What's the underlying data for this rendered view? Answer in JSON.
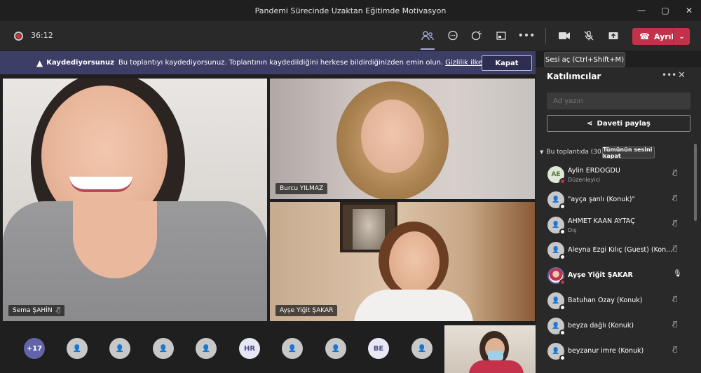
{
  "window": {
    "title": "Pandemi Sürecinde Uzaktan Eğitimde Motivasyon",
    "controls": [
      "—",
      "▢",
      "✕"
    ]
  },
  "toolbar": {
    "timer": "36:12",
    "leave_label": "Ayrıl",
    "tooltip": "Sesi aç (Ctrl+Shift+M)"
  },
  "banner": {
    "title": "Kaydediyorsunuz",
    "message": "Bu toplantıyı kaydediyorsunuz. Toplantının kaydedildiğini herkese bildirdiğinizden emin olun.",
    "link": "Gizlilik ilkesi",
    "dismiss": "Kapat"
  },
  "videos": [
    {
      "name": "Sema ŞAHİN"
    },
    {
      "name": "Burcu YILMAZ"
    },
    {
      "name": "Ayşe Yiğit ŞAKAR"
    }
  ],
  "bottom_bar": {
    "more_count": "+17",
    "avatars": [
      "",
      "",
      "",
      "",
      "HR",
      "",
      "",
      "BE",
      ""
    ]
  },
  "panel": {
    "title": "Katılımcılar",
    "search_placeholder": "Ad yazın",
    "share_label": "Daveti paylaş",
    "section_label": "Bu toplantıda (30)",
    "mute_all": "Tümünün sesini kapat",
    "participants": [
      {
        "name": "Aylin ERDOĞDU",
        "role": "Düzenleyici",
        "initials": "AE"
      },
      {
        "name": "\"ayça şanlı (Konuk)\"",
        "role": ""
      },
      {
        "name": "AHMET KAAN AYTAÇ",
        "role": "Dış"
      },
      {
        "name": "Aleyna Ezgi Kılıç (Guest) (Kon...",
        "role": ""
      },
      {
        "name": "Ayşe Yiğit ŞAKAR",
        "role": ""
      },
      {
        "name": "Batuhan Özay (Konuk)",
        "role": ""
      },
      {
        "name": "beyza dağlı (Konuk)",
        "role": ""
      },
      {
        "name": "beyzanur imre (Konuk)",
        "role": ""
      }
    ]
  }
}
